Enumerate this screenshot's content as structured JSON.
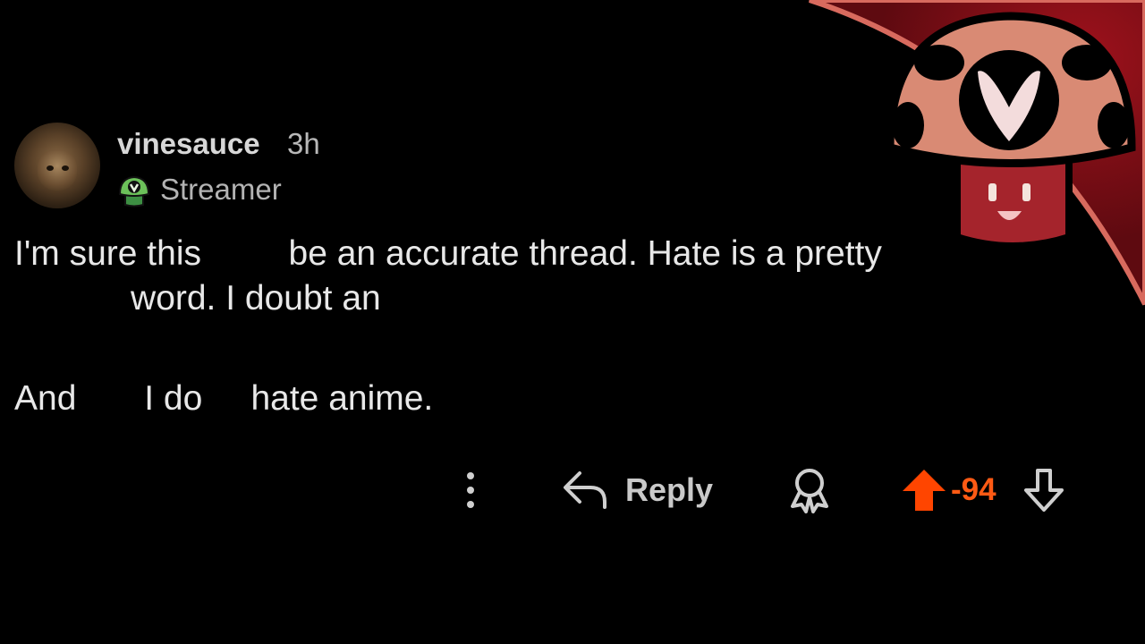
{
  "comment": {
    "author": "vinesauce",
    "age": "3h",
    "flair": "Streamer",
    "lines": [
      "I'm sure this         be an accurate thread. Hate is a pretty",
      "            word. I doubt an",
      "And       I do     hate anime."
    ]
  },
  "actions": {
    "reply_label": "Reply",
    "score": "-94",
    "upvote_color": "#ff4500",
    "icons": [
      "more-icon",
      "reply-icon",
      "award-icon",
      "upvote-icon",
      "downvote-icon"
    ]
  },
  "colors": {
    "background": "#000000",
    "corner_red": "#8b0f18",
    "mushroom_cap": "#d98a74",
    "mushroom_stem": "#a5242c"
  }
}
